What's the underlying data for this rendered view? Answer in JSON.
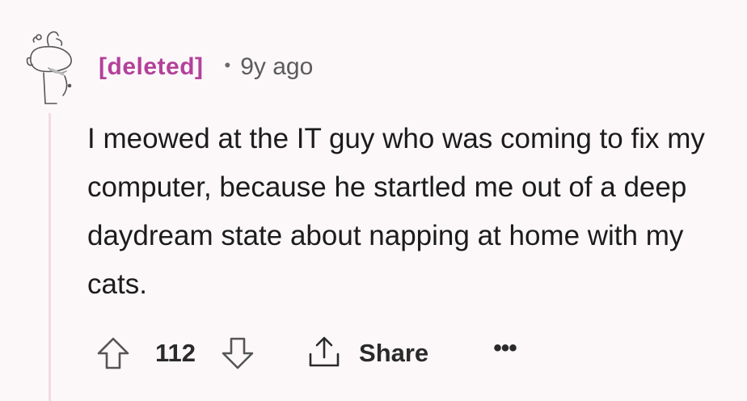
{
  "comment": {
    "author": "[deleted]",
    "separator": "•",
    "timestamp": "9y ago",
    "avatar_icon": "snoo-avatar-icon",
    "body": "I meowed at the IT guy who was coming to fix my computer, because he startled me out of a deep daydream state about napping at home with my cats.",
    "score": "112",
    "share_label": "Share",
    "more_label": "•••",
    "icons": {
      "upvote": "upvote-arrow-icon",
      "downvote": "downvote-arrow-icon",
      "share": "share-icon"
    },
    "colors": {
      "author": "#b3419a",
      "background": "#fcf8fa",
      "thread_line": "#f1dbe6"
    }
  }
}
